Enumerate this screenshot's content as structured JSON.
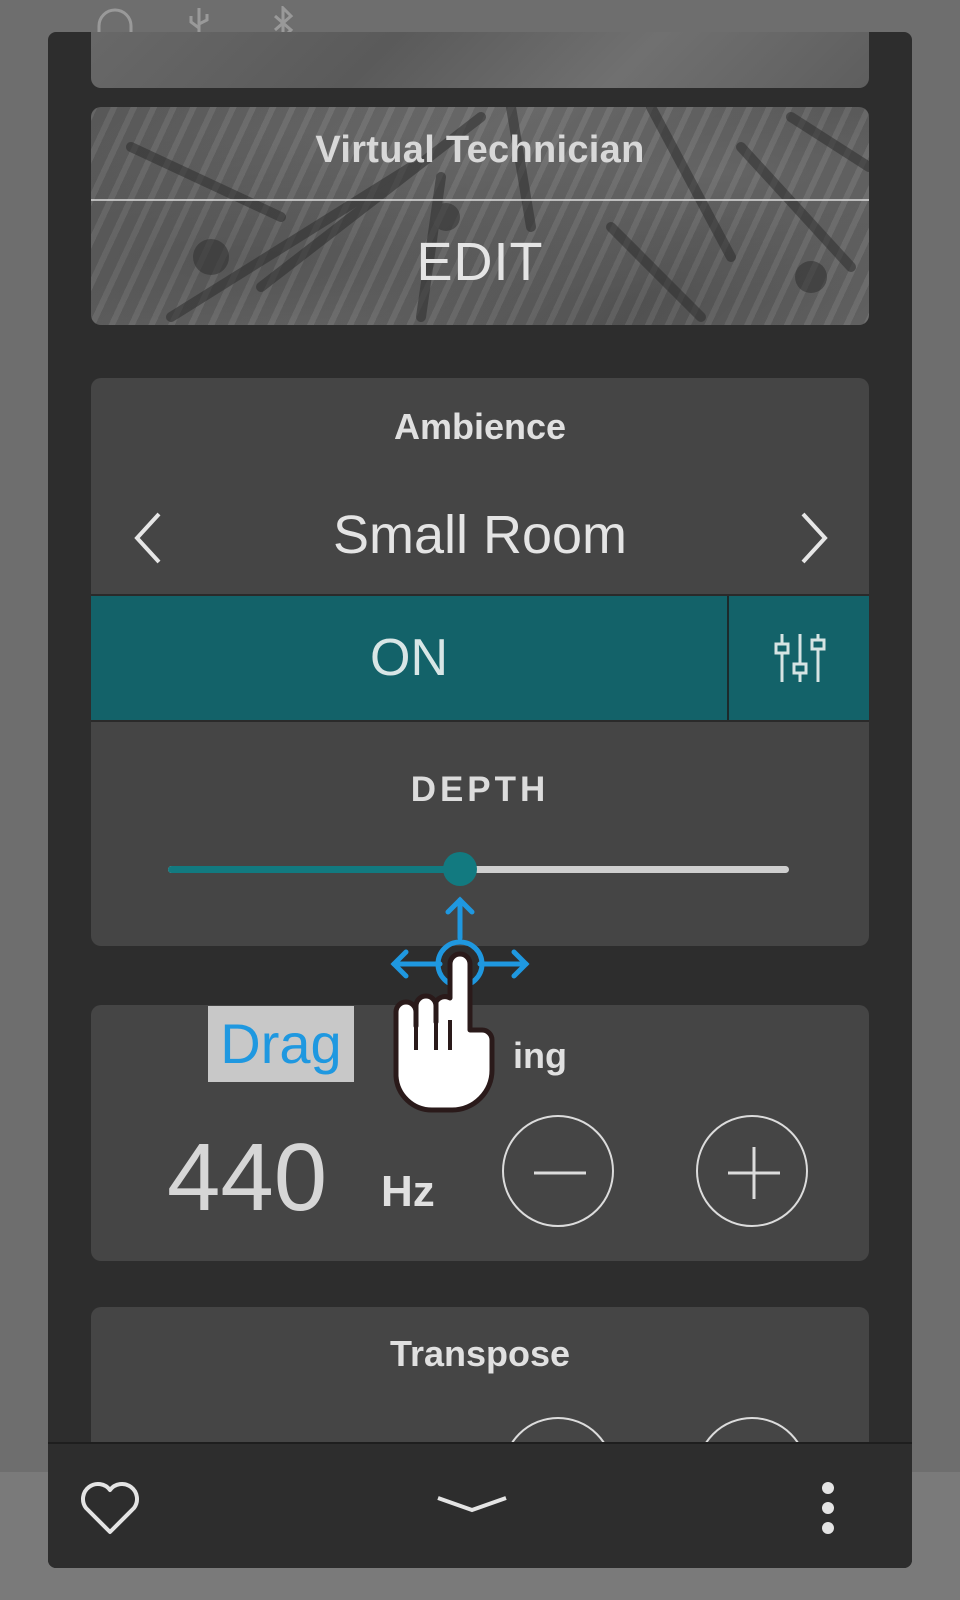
{
  "virtual_technician": {
    "title": "Virtual Technician",
    "action": "EDIT"
  },
  "ambience": {
    "title": "Ambience",
    "selected": "Small Room",
    "toggle_label": "ON",
    "depth_label": "DEPTH",
    "depth_level_fraction": 0.47,
    "accent_color": "#136269"
  },
  "tuning": {
    "title_visible": "ing",
    "value": "440",
    "unit": "Hz"
  },
  "transpose": {
    "title": "Transpose"
  },
  "gesture": {
    "label": "Drag",
    "label_color": "#1f98e0"
  },
  "icons": {
    "status": [
      "headphones-icon",
      "usb-icon",
      "bluetooth-icon"
    ],
    "ambience_prev": "chevron-left-icon",
    "ambience_next": "chevron-right-icon",
    "ambience_settings": "sliders-icon",
    "tuning_minus": "minus-icon",
    "tuning_plus": "plus-icon",
    "favorite": "heart-icon",
    "collapse": "chevron-down-icon",
    "more": "more-vertical-icon"
  }
}
